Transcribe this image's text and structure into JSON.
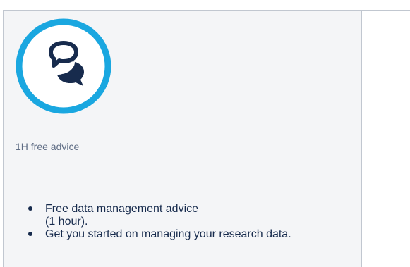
{
  "card": {
    "icon": "chat-bubbles-icon",
    "label": "1H free advice",
    "bullets": [
      {
        "line1": "Free data management advice",
        "line2": "(1 hour)."
      },
      {
        "line1": "Get you started on managing your research data.",
        "line2": ""
      }
    ]
  },
  "colors": {
    "badge_ring": "#1aa7e0",
    "icon": "#172b4d",
    "label": "#5e6c84",
    "cell_bg": "#f4f5f7",
    "border": "#c1c7d0"
  }
}
